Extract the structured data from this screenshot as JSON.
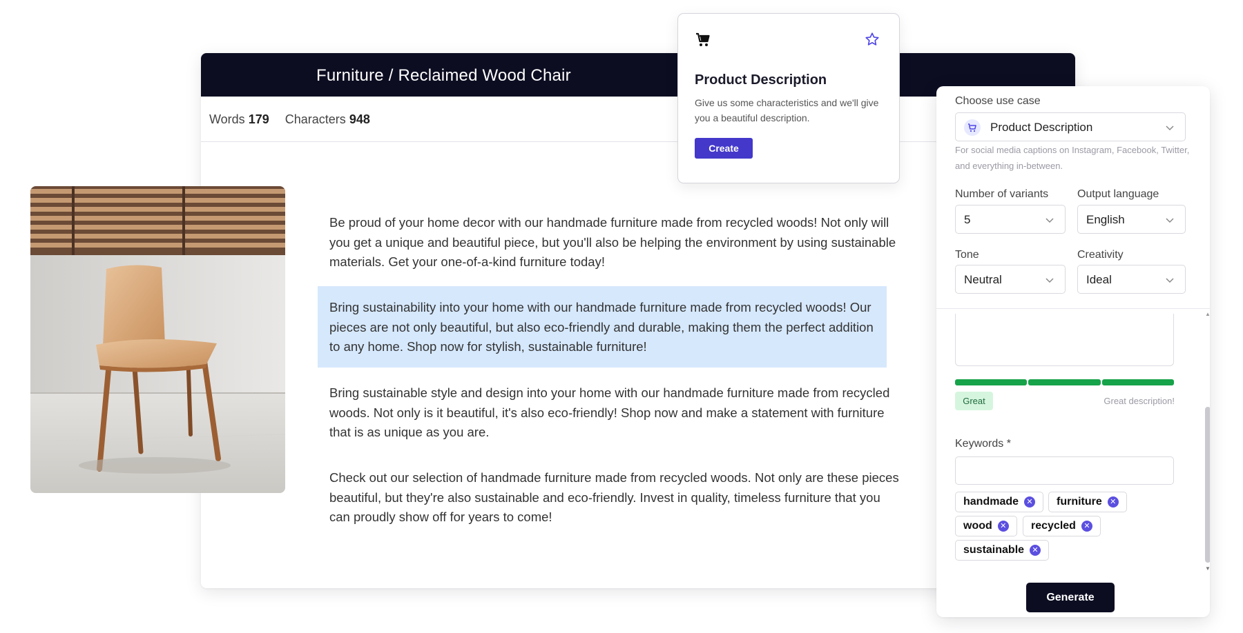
{
  "editor": {
    "title": "Furniture / Reclaimed Wood Chair",
    "stats": {
      "words_label": "Words",
      "words_value": "179",
      "chars_label": "Characters",
      "chars_value": "948"
    },
    "paragraphs": [
      "Be proud of your home decor with our handmade furniture made from recycled woods! Not only will you get a unique and beautiful piece, but you'll also be helping the environment by using sustainable materials. Get your one-of-a-kind furniture today!",
      "Bring sustainability into your home with our handmade furniture made from recycled woods! Our pieces are not only beautiful, but also eco-friendly and durable, making them the perfect addition to any home. Shop now for stylish, sustainable furniture!",
      "Bring sustainable style and design into your home with our handmade furniture made from recycled woods. Not only is it beautiful, it's also eco-friendly! Shop now and make a statement with furniture that is as unique as you are.",
      "Check out our selection of handmade furniture made from recycled woods. Not only are these pieces beautiful, but they're also sustainable and eco-friendly. Invest in quality, timeless furniture that you can proudly show off for years to come!"
    ],
    "highlight_color": "#d6e8fc"
  },
  "popup": {
    "icons": [
      "cart-icon",
      "star-icon"
    ],
    "title": "Product Description",
    "description": "Give us some characteristics and we'll give you a beautiful description.",
    "button_label": "Create",
    "accent": "#4338ca"
  },
  "panel": {
    "use_case_label": "Choose use case",
    "use_case_value": "Product Description",
    "use_case_hint": "For social media captions on Instagram, Facebook, Twitter, and everything in-between.",
    "variants_label": "Number of variants",
    "variants_value": "5",
    "language_label": "Output language",
    "language_value": "English",
    "tone_label": "Tone",
    "tone_value": "Neutral",
    "creativity_label": "Creativity",
    "creativity_value": "Ideal",
    "quality_badge": "Great",
    "quality_note": "Great description!",
    "quality_color": "#17a34a",
    "keywords_label": "Keywords *",
    "keywords": [
      "handmade",
      "furniture",
      "wood",
      "recycled",
      "sustainable"
    ],
    "generate_label": "Generate"
  }
}
